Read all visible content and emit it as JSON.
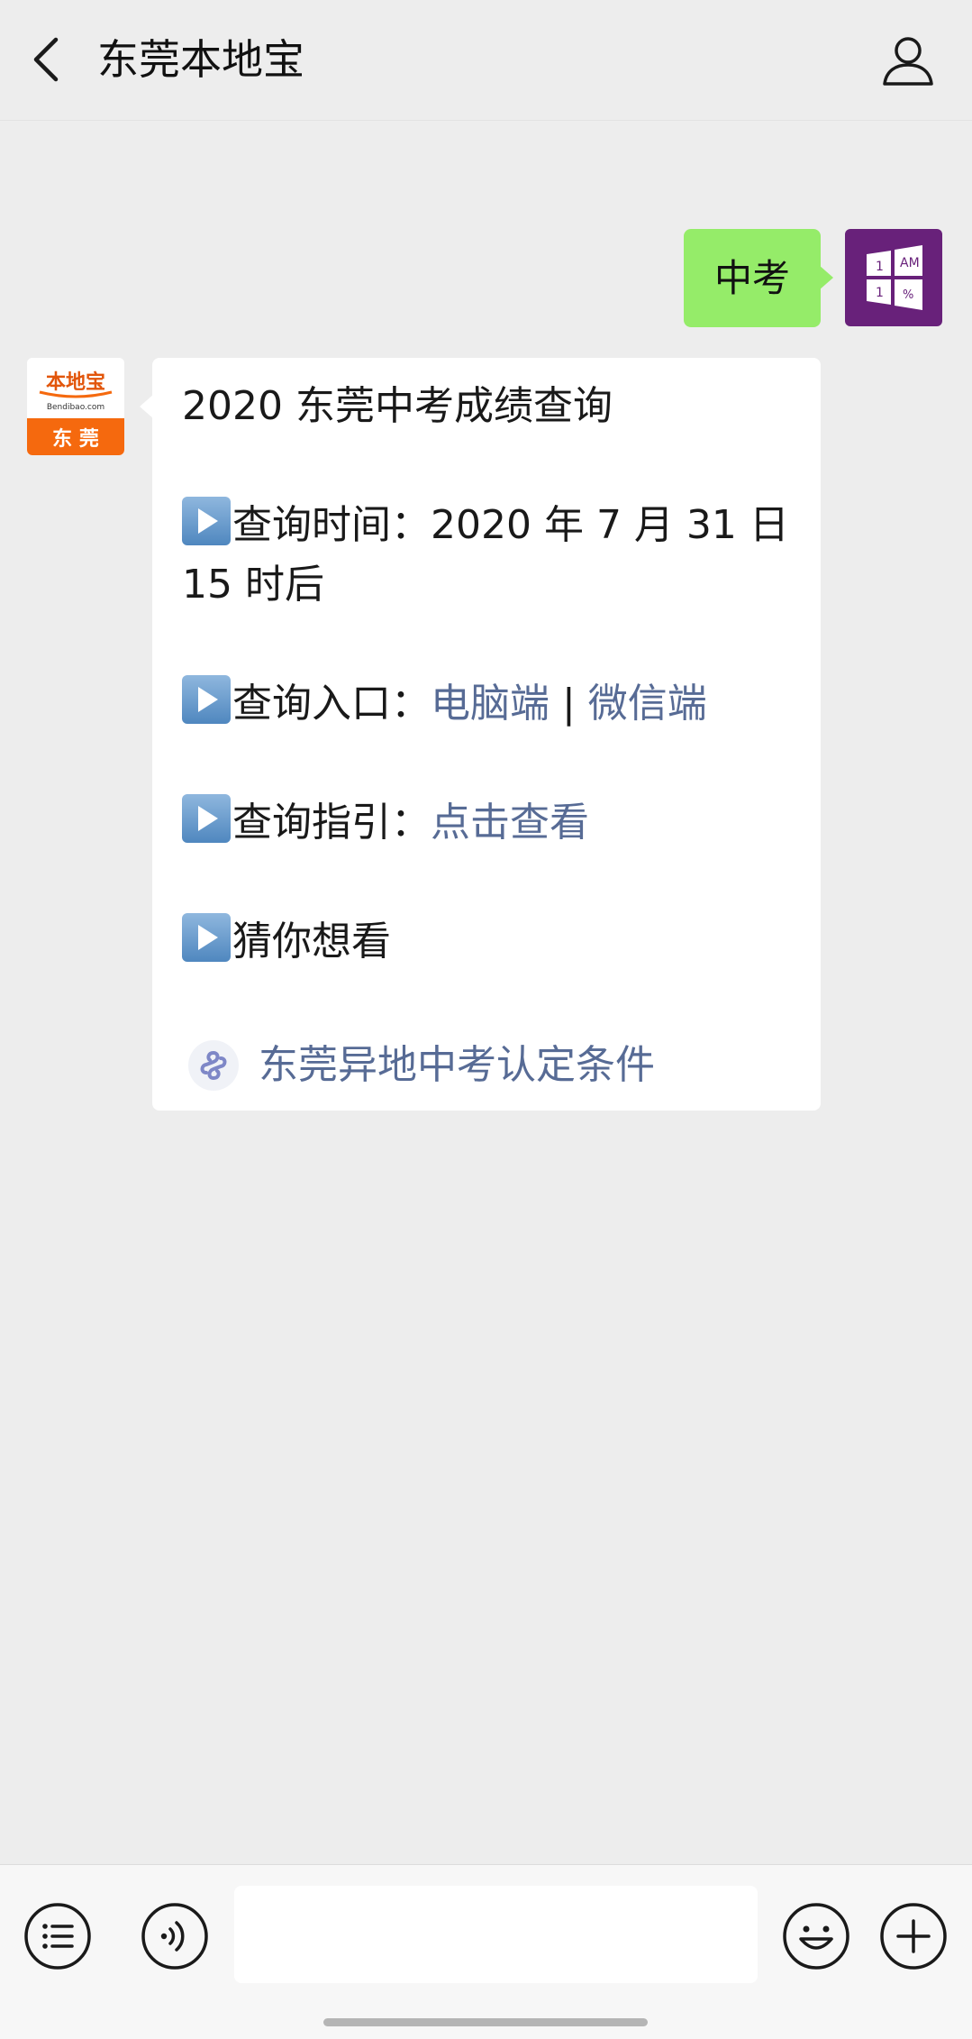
{
  "header": {
    "title": "东莞本地宝",
    "back_icon": "chevron-left-icon",
    "profile_icon": "person-icon"
  },
  "user_message": {
    "text": "中考"
  },
  "user_avatar": {
    "icon": "windows-calculator-icon",
    "labels": [
      "1",
      "AM",
      "1",
      "%"
    ],
    "bg_color": "#68217a"
  },
  "bot_avatar": {
    "brand": "本地宝",
    "domain": "Bendibao.com",
    "city": "东 莞",
    "accent_color": "#f5690e"
  },
  "bot_message": {
    "title": "2020 东莞中考成绩查询",
    "time_line": "查询时间：2020 年 7 月 31 日",
    "time_line_2": "15 时后",
    "entry_label": "查询入口：",
    "entry_link_pc": "电脑端",
    "entry_separator": " | ",
    "entry_link_wechat": "微信端",
    "guide_label": "查询指引：",
    "guide_link": "点击查看",
    "guess_label": "猜你想看",
    "mini_program_link": "东莞异地中考认定条件",
    "link_color": "#576b95"
  },
  "bottom_bar": {
    "menu_icon": "menu-list-icon",
    "voice_icon": "voice-icon",
    "input_value": "",
    "emoji_icon": "emoji-icon",
    "plus_icon": "plus-icon"
  }
}
